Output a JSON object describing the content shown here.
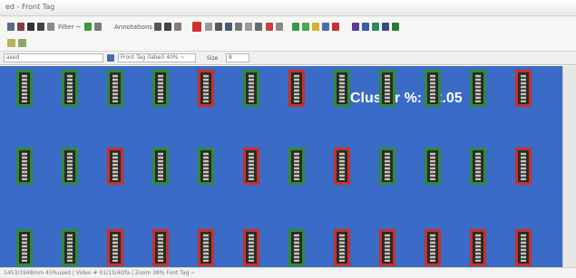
{
  "window": {
    "title": "ed - Front Tag"
  },
  "toolbar": {
    "filter_label": "Filter ~",
    "annotations_label": "Annotations"
  },
  "filterbar": {
    "name_value": "ased",
    "template_value": "Front Tag (label) 40% ~",
    "size_label": "Size",
    "size_value": "8"
  },
  "main": {
    "cluster_text": "Cluster %: 62.05",
    "colors": {
      "background": "#3a6bc6",
      "match": "#2f8a3a",
      "mismatch": "#c9302c"
    },
    "rows": [
      [
        "green",
        "green",
        "green",
        "green",
        "red",
        "green",
        "red",
        "green",
        "green",
        "green",
        "green",
        "red"
      ],
      [
        "green",
        "green",
        "red",
        "green",
        "green",
        "red",
        "green",
        "red",
        "green",
        "green",
        "green",
        "red"
      ],
      [
        "green",
        "green",
        "red",
        "red",
        "red",
        "red",
        "green",
        "red",
        "red",
        "red",
        "red",
        "red"
      ]
    ]
  },
  "status": {
    "text": "1453/1948mm 45%used | Video # 01/13/4Ofa | Zoom 38% Font Tag ~"
  }
}
